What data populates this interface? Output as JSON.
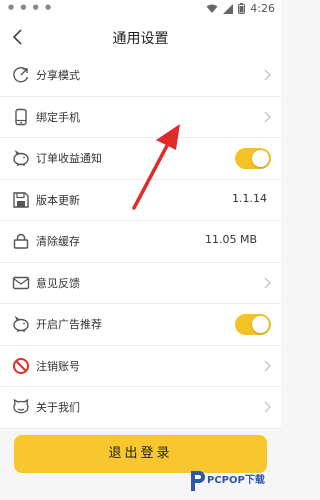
{
  "status_bar": {
    "time": "4:26"
  },
  "header": {
    "title": "通用设置"
  },
  "rows": [
    {
      "label": "分享模式",
      "icon": "share-icon",
      "control": "chevron"
    },
    {
      "label": "绑定手机",
      "icon": "phone-icon",
      "control": "chevron"
    },
    {
      "label": "订单收益通知",
      "icon": "piggy-bank-icon",
      "control": "toggle",
      "toggle_on": true
    },
    {
      "label": "版本更新",
      "icon": "save-icon",
      "control": "value",
      "value": "1.1.14"
    },
    {
      "label": "清除缓存",
      "icon": "lock-icon",
      "control": "value",
      "value": "11.05 MB"
    },
    {
      "label": "意见反馈",
      "icon": "mail-icon",
      "control": "chevron"
    },
    {
      "label": "开启广告推荐",
      "icon": "piggy-bank-icon",
      "control": "toggle",
      "toggle_on": true
    },
    {
      "label": "注销账号",
      "icon": "forbidden-icon",
      "control": "chevron"
    },
    {
      "label": "关于我们",
      "icon": "about-face-icon",
      "control": "chevron"
    }
  ],
  "logout": {
    "label": "退出登录"
  },
  "watermark": {
    "text": "PCPOP下载"
  },
  "colors": {
    "accent": "#f8c62e",
    "arrow": "#e02b2b"
  }
}
